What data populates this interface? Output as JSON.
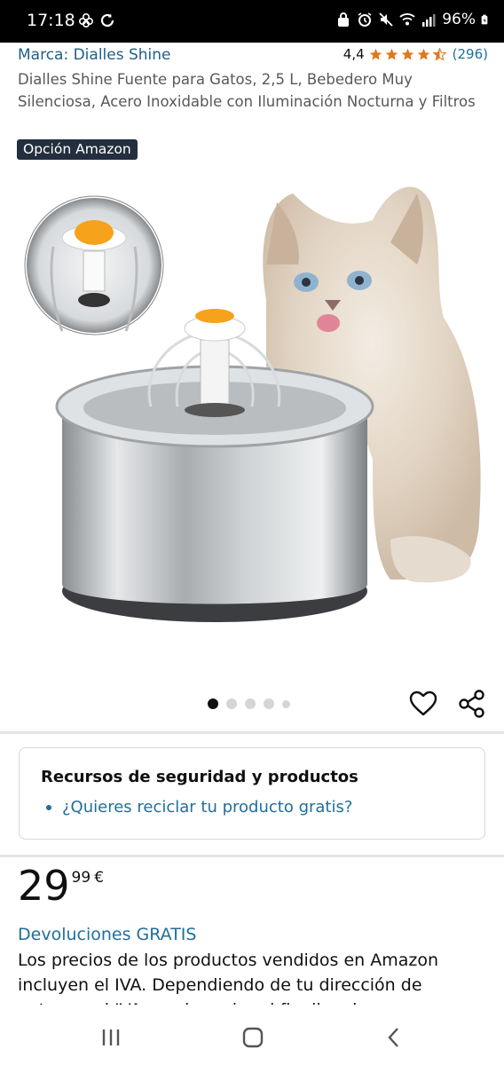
{
  "status_bar": {
    "time": "17:18",
    "battery": "96%",
    "icons": [
      "flower-icon",
      "sync-icon",
      "alarm-icon",
      "mute-icon",
      "wifi-icon",
      "signal-icon",
      "battery-icon"
    ]
  },
  "product": {
    "brand": "Marca: Dialles Shine",
    "rating_value": "4,4",
    "rating_stars": 4.4,
    "review_count": "(296)",
    "title": "Dialles Shine Fuente para Gatos, 2,5 L, Bebedero Muy Silenciosa, Acero Inoxidable con Iluminación Nocturna y Filtros",
    "badge": "Opción Amazon",
    "image_icon": "cat-water-fountain-image"
  },
  "carousel": {
    "total": 5,
    "active_index": 0
  },
  "actions": {
    "favorite_icon": "heart-icon",
    "share_icon": "share-icon"
  },
  "safety": {
    "title": "Recursos de seguridad y productos",
    "item": "¿Quieres reciclar tu producto gratis?"
  },
  "price": {
    "whole": "29",
    "fraction": "99",
    "currency": "€"
  },
  "returns_label": "Devoluciones GRATIS",
  "tax_text": "Los precios de los productos vendidos en Amazon incluyen el IVA. Dependiendo de tu dirección de entrega, el IVA puede variar al finalizar la compra.",
  "nav_bar": {
    "icons": [
      "recent-apps-icon",
      "home-icon",
      "back-icon"
    ]
  },
  "colors": {
    "link": "#1f6f9a",
    "star": "#de7921",
    "badge_bg": "#232f3e"
  }
}
